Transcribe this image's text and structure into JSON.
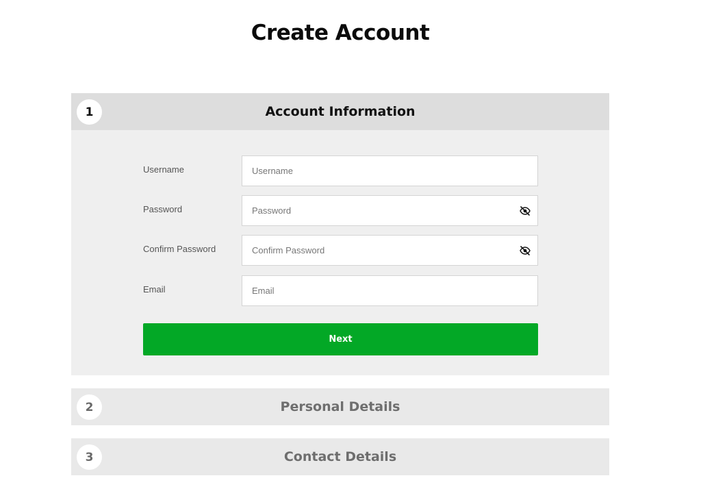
{
  "page": {
    "title": "Create Account"
  },
  "steps": [
    {
      "number": "1",
      "title": "Account Information"
    },
    {
      "number": "2",
      "title": "Personal Details"
    },
    {
      "number": "3",
      "title": "Contact Details"
    }
  ],
  "form": {
    "username": {
      "label": "Username",
      "placeholder": "Username",
      "value": ""
    },
    "password": {
      "label": "Password",
      "placeholder": "Password",
      "value": "",
      "toggle_icon": "eye-slash-icon"
    },
    "confirm_password": {
      "label": "Confirm Password",
      "placeholder": "Confirm Password",
      "value": "",
      "toggle_icon": "eye-slash-icon"
    },
    "email": {
      "label": "Email",
      "placeholder": "Email",
      "value": ""
    },
    "next_label": "Next"
  },
  "colors": {
    "primary_button": "#03a826",
    "active_header": "#dddddd",
    "inactive_header": "#e9e9e9",
    "panel_background": "#efefef"
  }
}
